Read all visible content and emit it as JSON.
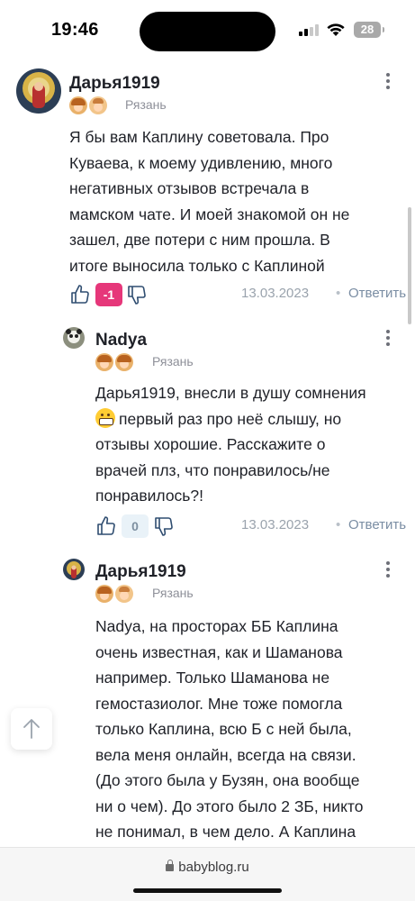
{
  "status_bar": {
    "time": "19:46",
    "battery": "28"
  },
  "comments": [
    {
      "username": "Дарья1919",
      "city": "Рязань",
      "badges": [
        "girl-badge",
        "boy-badge"
      ],
      "lines": [
        "Я бы вам Каплину советовала. Про",
        "Куваева, к моему удивлению, много",
        "негативных отзывов встречала в",
        "мамском чате. И моей знакомой он не",
        "зашел, две потери с ним прошла. В",
        "итоге выносила только с Каплиной"
      ],
      "rating": "-1",
      "date": "13.03.2023",
      "reply_label": "Ответить"
    },
    {
      "username": "Nadya",
      "city": "Рязань",
      "badges": [
        "girl-badge",
        "girl-badge"
      ],
      "lines": [
        "Дарья1919, внесли в душу сомнения",
        "первый раз про неё слышу, но",
        "отзывы хорошие. Расскажите о",
        "врачей плз, что понравилось/не",
        "понравилось?!"
      ],
      "rating": "0",
      "date": "13.03.2023",
      "reply_label": "Ответить"
    },
    {
      "username": "Дарья1919",
      "city": "Рязань",
      "badges": [
        "girl-badge",
        "boy-badge"
      ],
      "lines": [
        "Nadya, на просторах ББ Каплина",
        "очень известная, как и Шаманова",
        "например. Только Шаманова не",
        "гемостазиолог. Мне тоже помогла",
        "только Каплина, всю Б с ней была,",
        "вела меня онлайн, всегда на связи.",
        "(До этого была у Бузян, она вообще",
        "ни о чем). До этого было 2 ЗБ, никто",
        "не понимал, в чем дело. А Каплина"
      ]
    }
  ],
  "browser": {
    "url": "babyblog.ru"
  }
}
